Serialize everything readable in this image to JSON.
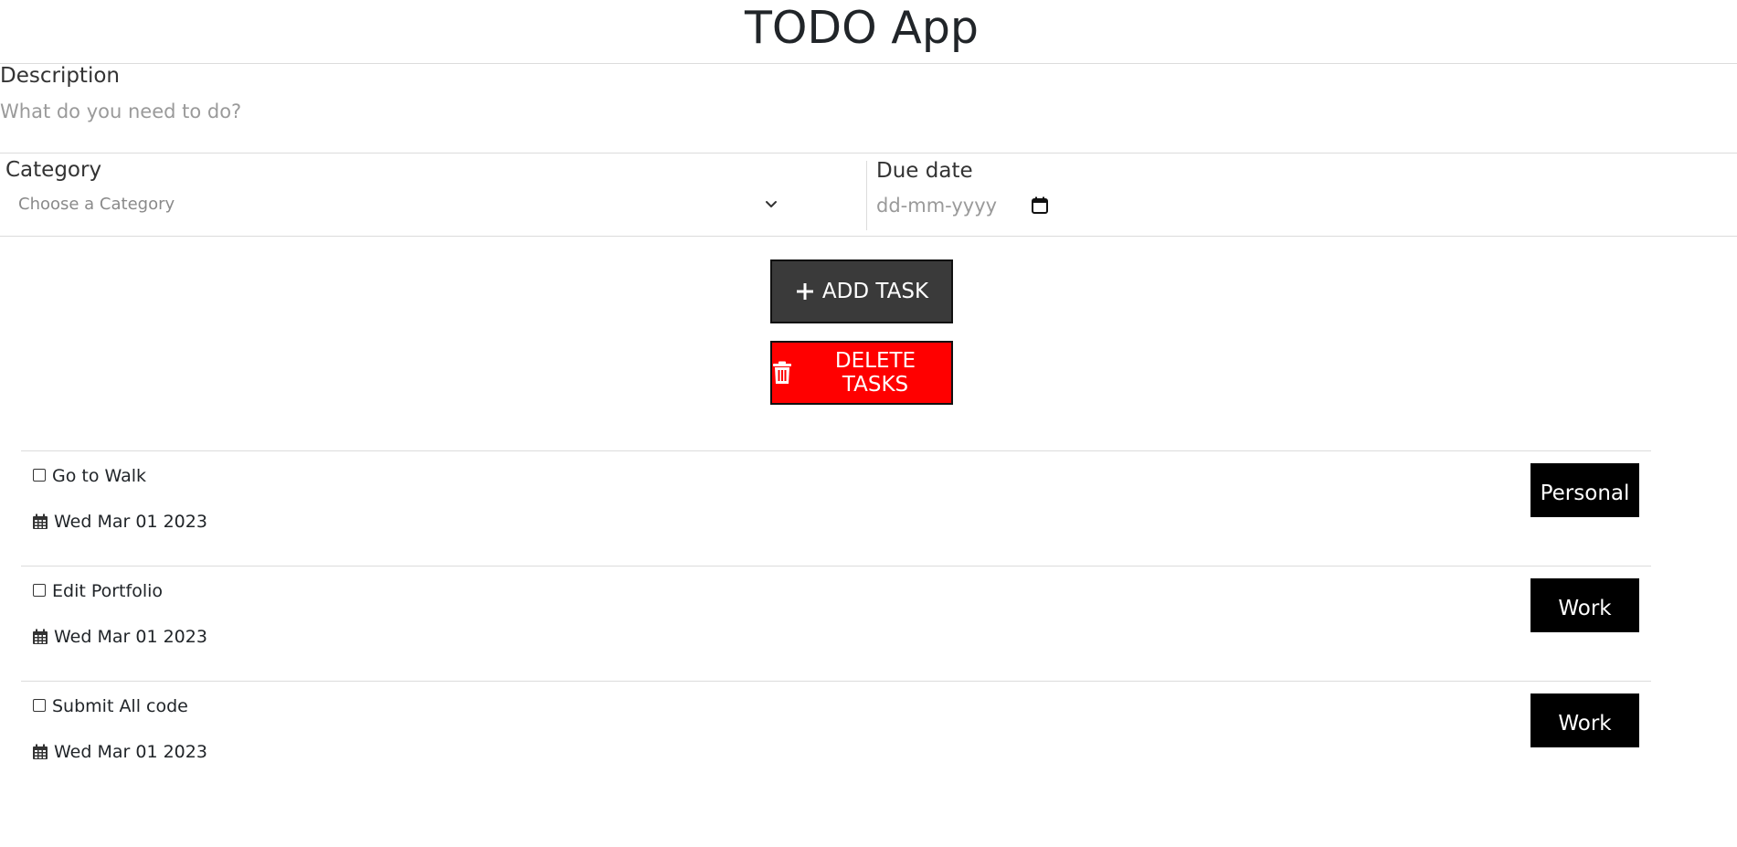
{
  "app_title": "TODO App",
  "form": {
    "description_label": "Description",
    "description_placeholder": "What do you need to do?",
    "category_label": "Category",
    "category_placeholder": "Choose a Category",
    "due_date_label": "Due date",
    "due_date_placeholder": "dd-mm-yyyy"
  },
  "buttons": {
    "add_label": "ADD TASK",
    "delete_label": "DELETE TASKS",
    "add_color": "#3a3a3a",
    "delete_color": "#ff0000"
  },
  "tasks": [
    {
      "description": "Go to Walk",
      "date": "Wed Mar 01 2023",
      "category": "Personal",
      "checked": false
    },
    {
      "description": "Edit Portfolio",
      "date": "Wed Mar 01 2023",
      "category": "Work",
      "checked": false
    },
    {
      "description": "Submit All code",
      "date": "Wed Mar 01 2023",
      "category": "Work",
      "checked": false
    }
  ],
  "icons": {
    "category_dropdown": "chevron-down-icon",
    "due_date_picker": "calendar-icon",
    "add_button": "plus-icon",
    "delete_button": "trash-icon",
    "task_date": "calendar-icon"
  }
}
